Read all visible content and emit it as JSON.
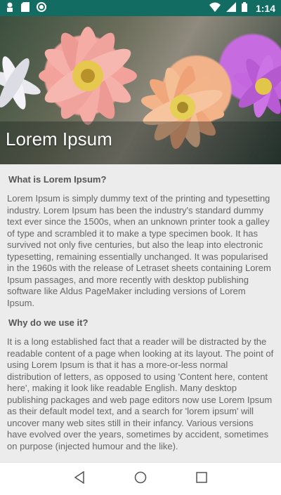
{
  "status_bar": {
    "time": "1:14",
    "icons": [
      "notification-icon",
      "sd-card-icon",
      "record-icon",
      "wifi-icon",
      "signal-icon",
      "battery-icon"
    ]
  },
  "hero": {
    "title": "Lorem Ipsum",
    "image": "dahlia-flowers-photo"
  },
  "content": {
    "sections": [
      {
        "heading": "What is Lorem Ipsum?",
        "body": "Lorem Ipsum is simply dummy text of the printing and typesetting industry. Lorem Ipsum has been the industry's standard dummy text ever since the 1500s, when an unknown printer took a galley of type and scrambled it to make a type specimen book. It has survived not only five centuries, but also the leap into electronic typesetting, remaining essentially unchanged. It was popularised in the 1960s with the release of Letraset sheets containing Lorem Ipsum passages, and more recently with desktop publishing software like Aldus PageMaker including versions of Lorem Ipsum."
      },
      {
        "heading": "Why do we use it?",
        "body": "It is a long established fact that a reader will be distracted by the readable content of a page when looking at its layout. The point of using Lorem Ipsum is that it has a more-or-less normal distribution of letters, as opposed to using 'Content here, content here', making it look like readable English. Many desktop publishing packages and web page editors now use Lorem Ipsum as their default model text, and a search for 'lorem ipsum' will uncover many web sites still in their infancy. Various versions have evolved over the years, sometimes by accident, sometimes on purpose (injected humour and the like)."
      }
    ]
  },
  "nav_bar": {
    "buttons": [
      "back-icon",
      "home-icon",
      "recents-icon"
    ]
  },
  "colors": {
    "status_bar": "#136c61",
    "content_bg": "#ececec",
    "text": "#666666"
  }
}
